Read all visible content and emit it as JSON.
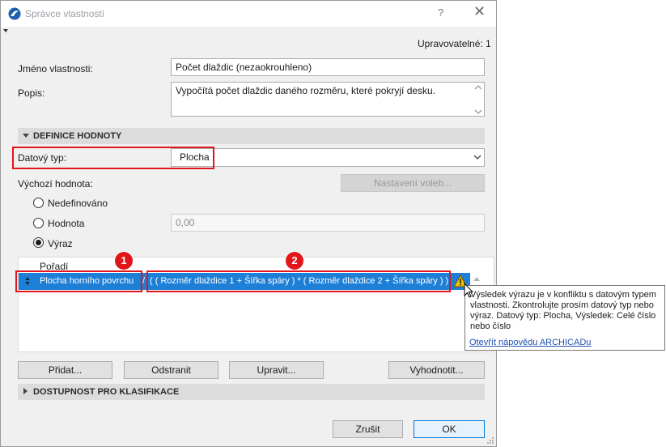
{
  "window": {
    "title": "Správce vlastností",
    "help_label": "?",
    "close_label": "✕",
    "editable_label": "Upravovatelné: 1"
  },
  "property": {
    "name_label": "Jméno vlastnosti:",
    "name_value": "Počet dlaždic (nezaokrouhleno)",
    "description_label": "Popis:",
    "description_value": "Vypočítá počet dlaždic daného rozměru, které pokryjí desku."
  },
  "definition": {
    "section_title": "DEFINICE HODNOTY",
    "data_type_label": "Datový typ:",
    "data_type_value": "Plocha",
    "default_value_label": "Výchozí hodnota:",
    "options_button": "Nastavení voleb...",
    "radio_options": [
      {
        "label": "Nedefinováno",
        "checked": false
      },
      {
        "label": "Hodnota",
        "checked": false
      },
      {
        "label": "Výraz",
        "checked": true
      }
    ],
    "value_field": "0,00"
  },
  "expression_list": {
    "column_header": "Pořadí",
    "row": {
      "name": "Plocha horního povrchu",
      "separator": "/",
      "expression": "( ( Rozměr dlaždice 1 + Šířka spáry ) * ( Rozměr dlaždice 2 + Šířka spáry ) )"
    }
  },
  "callouts": [
    "1",
    "2"
  ],
  "warning_tooltip": {
    "icon": "warning-icon",
    "text": "Výsledek výrazu je v konfliktu s datovým typem vlastnosti. Zkontrolujte prosím datový typ nebo výraz. Datový typ: Plocha, Výsledek: Celé číslo nebo číslo",
    "link": "Otevřít nápovědu ARCHICADu"
  },
  "actions": {
    "add": "Přidat...",
    "remove": "Odstranit",
    "edit": "Upravit...",
    "evaluate": "Vyhodnotit..."
  },
  "classification_section": "DOSTUPNOST PRO KLASIFIKACE",
  "footer": {
    "cancel": "Zrušit",
    "ok": "OK"
  },
  "colors": {
    "accent": "#1e7fd7",
    "highlight": "#e2161a",
    "warning": "#f2c200"
  }
}
